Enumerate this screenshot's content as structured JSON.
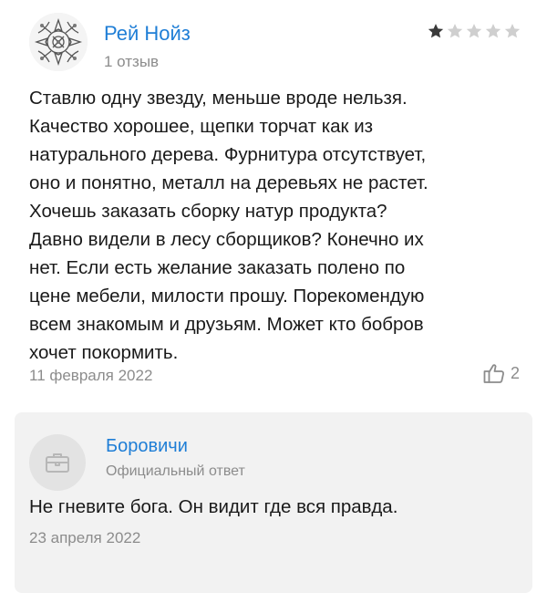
{
  "review": {
    "author": {
      "name": "Рей Нойз",
      "reviews_count": "1 отзыв",
      "avatar_icon": "ornament-avatar-icon"
    },
    "rating": {
      "value": 1,
      "max": 5,
      "filled_color": "#3a3a3a",
      "empty_color": "#cfcfcf"
    },
    "text_lines": [
      "Ставлю одну звезду, меньше вроде нельзя.",
      "Качество хорошее, щепки торчат как из",
      "натурального дерева. Фурнитура отсутствует,",
      "оно и понятно, металл на деревьях не растет.",
      "Хочешь заказать сборку натур продукта?",
      "Давно видели в лесу сборщиков? Конечно их",
      "нет. Если есть желание заказать полено по",
      "цене мебели, милости прошу. Порекомендую",
      "всем знакомым и друзьям. Может кто бобров",
      "хочет покормить."
    ],
    "date": "11 февраля 2022",
    "likes": {
      "count": "2",
      "icon": "thumbs-up-icon"
    }
  },
  "response": {
    "company": "Боровичи",
    "label": "Официальный ответ",
    "avatar_icon": "briefcase-icon",
    "text": "Не гневите бога. Он видит где вся правда.",
    "date": "23 апреля 2022"
  },
  "colors": {
    "link": "#1f7ed6",
    "muted": "#8c8c8c",
    "response_bg": "#f2f2f2"
  }
}
